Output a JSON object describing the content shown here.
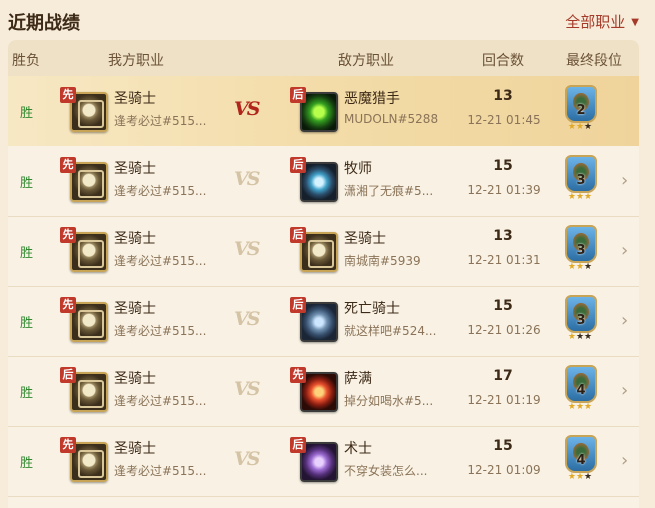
{
  "header": {
    "title": "近期战绩",
    "filter": "全部职业"
  },
  "columns": {
    "result": "胜负",
    "my_class": "我方职业",
    "vs_class": "敌方职业",
    "turns": "回合数",
    "final_rank": "最终段位"
  },
  "vs_text": "VS",
  "rows": [
    {
      "result": "胜",
      "my_order": "先",
      "my_class": "圣骑士",
      "my_player": "逢考必过#515...",
      "opp_order": "后",
      "opp_class": "恶魔猎手",
      "opp_player": "MUDOLN#5288",
      "turns": "13",
      "time": "12-21 01:45",
      "rank": "2",
      "stars": 2,
      "active": true
    },
    {
      "result": "胜",
      "my_order": "先",
      "my_class": "圣骑士",
      "my_player": "逢考必过#515...",
      "opp_order": "后",
      "opp_class": "牧师",
      "opp_player": "潇湘了无痕#5...",
      "turns": "15",
      "time": "12-21 01:39",
      "rank": "3",
      "stars": 3
    },
    {
      "result": "胜",
      "my_order": "先",
      "my_class": "圣骑士",
      "my_player": "逢考必过#515...",
      "opp_order": "后",
      "opp_class": "圣骑士",
      "opp_player": "南城南#5939",
      "turns": "13",
      "time": "12-21 01:31",
      "rank": "3",
      "stars": 2
    },
    {
      "result": "胜",
      "my_order": "先",
      "my_class": "圣骑士",
      "my_player": "逢考必过#515...",
      "opp_order": "后",
      "opp_class": "死亡骑士",
      "opp_player": "就这样吧#524...",
      "turns": "15",
      "time": "12-21 01:26",
      "rank": "3",
      "stars": 1
    },
    {
      "result": "胜",
      "my_order": "后",
      "my_class": "圣骑士",
      "my_player": "逢考必过#515...",
      "opp_order": "先",
      "opp_class": "萨满",
      "opp_player": "掉分如喝水#5...",
      "turns": "17",
      "time": "12-21 01:19",
      "rank": "4",
      "stars": 3
    },
    {
      "result": "胜",
      "my_order": "先",
      "my_class": "圣骑士",
      "my_player": "逢考必过#515...",
      "opp_order": "后",
      "opp_class": "术士",
      "opp_player": "不穿女装怎么...",
      "turns": "15",
      "time": "12-21 01:09",
      "rank": "4",
      "stars": 2
    }
  ],
  "icons": {
    "my_card": "paladin-card-icon",
    "opp_cards": [
      "demon-hunter-card-icon",
      "priest-card-icon",
      "paladin-card-icon",
      "death-knight-card-icon",
      "shaman-card-icon",
      "warlock-card-icon"
    ]
  }
}
